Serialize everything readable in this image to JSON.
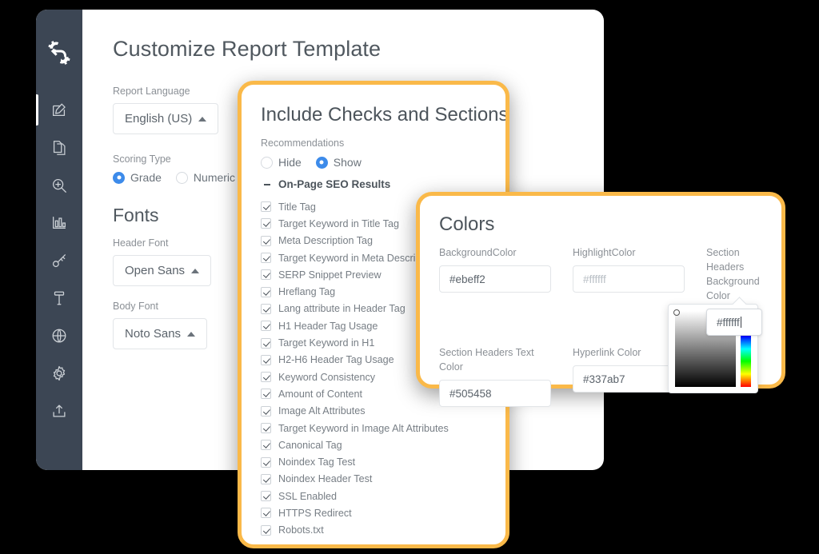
{
  "app": {
    "logo_icon": "gears-logo-icon"
  },
  "sidebar": {
    "items": [
      {
        "icon": "edit-pencil-icon",
        "name": "sidebar-item-edit",
        "active": true
      },
      {
        "icon": "copy-files-icon",
        "name": "sidebar-item-copy",
        "active": false
      },
      {
        "icon": "magnifier-plus-icon",
        "name": "sidebar-item-inspect",
        "active": false
      },
      {
        "icon": "bar-chart-icon",
        "name": "sidebar-item-reports",
        "active": false
      },
      {
        "icon": "key-icon",
        "name": "sidebar-item-keywords",
        "active": false
      },
      {
        "icon": "hammer-icon",
        "name": "sidebar-item-tools",
        "active": false
      },
      {
        "icon": "globe-icon",
        "name": "sidebar-item-site",
        "active": false
      },
      {
        "icon": "gear-icon",
        "name": "sidebar-item-settings",
        "active": false
      },
      {
        "icon": "upload-icon",
        "name": "sidebar-item-export",
        "active": false
      }
    ]
  },
  "main": {
    "title": "Customize Report Template",
    "report_language": {
      "label": "Report Language",
      "value": "English (US)",
      "caret": "caret-up-icon"
    },
    "scoring_type": {
      "label": "Scoring Type",
      "options": [
        {
          "label": "Grade",
          "selected": true
        },
        {
          "label": "Numeric",
          "selected": false
        }
      ]
    },
    "fonts": {
      "heading": "Fonts",
      "header_font": {
        "label": "Header Font",
        "value": "Open Sans"
      },
      "body_font": {
        "label": "Body Font",
        "value": "Noto Sans"
      }
    }
  },
  "checks_panel": {
    "heading": "Include Checks and Sections",
    "recommendations_label": "Recommendations",
    "recommendations_options": [
      {
        "label": "Hide",
        "selected": false
      },
      {
        "label": "Show",
        "selected": true
      }
    ],
    "group_title": "On-Page SEO Results",
    "group_toggle_icon": "minus-collapse-icon",
    "items": [
      {
        "label": "Title Tag",
        "checked": true
      },
      {
        "label": "Target Keyword in Title Tag",
        "checked": true
      },
      {
        "label": "Meta Description Tag",
        "checked": true
      },
      {
        "label": "Target Keyword in Meta Description",
        "checked": true
      },
      {
        "label": "SERP Snippet Preview",
        "checked": true
      },
      {
        "label": "Hreflang Tag",
        "checked": true
      },
      {
        "label": "Lang attribute in Header Tag",
        "checked": true
      },
      {
        "label": "H1 Header Tag Usage",
        "checked": true
      },
      {
        "label": "Target Keyword in H1",
        "checked": true
      },
      {
        "label": "H2-H6 Header Tag Usage",
        "checked": true
      },
      {
        "label": "Keyword Consistency",
        "checked": true
      },
      {
        "label": "Amount of Content",
        "checked": true
      },
      {
        "label": "Image Alt Attributes",
        "checked": true
      },
      {
        "label": "Target Keyword in Image Alt Attributes",
        "checked": true
      },
      {
        "label": "Canonical Tag",
        "checked": true
      },
      {
        "label": "Noindex Tag Test",
        "checked": true
      },
      {
        "label": "Noindex Header Test",
        "checked": true
      },
      {
        "label": "SSL Enabled",
        "checked": true
      },
      {
        "label": "HTTPS Redirect",
        "checked": true
      },
      {
        "label": "Robots.txt",
        "checked": true
      }
    ]
  },
  "colors_panel": {
    "heading": "Colors",
    "fields": [
      {
        "label": "BackgroundColor",
        "value": "#ebeff2",
        "placeholder": "",
        "state": "filled"
      },
      {
        "label": "HighlightColor",
        "value": "",
        "placeholder": "#ffffff",
        "state": "placeholder"
      },
      {
        "label": "Section Headers Background Color",
        "value": "#ffffff",
        "placeholder": "",
        "state": "focused"
      },
      {
        "label": "Section Headers Text Color",
        "value": "#505458",
        "placeholder": "",
        "state": "filled"
      },
      {
        "label": "Hyperlink Color",
        "value": "#337ab7",
        "placeholder": "",
        "state": "filled"
      }
    ],
    "picker": {
      "name": "color-picker-popover",
      "sv_area": "saturation-value-square",
      "hue_area": "hue-slider-strip"
    }
  },
  "theme": {
    "accent_orange": "#fab949",
    "sidebar_dark": "#3c4654",
    "radio_blue": "#3d8bea",
    "text_dark": "#50585f",
    "text_muted": "#8b9096"
  }
}
